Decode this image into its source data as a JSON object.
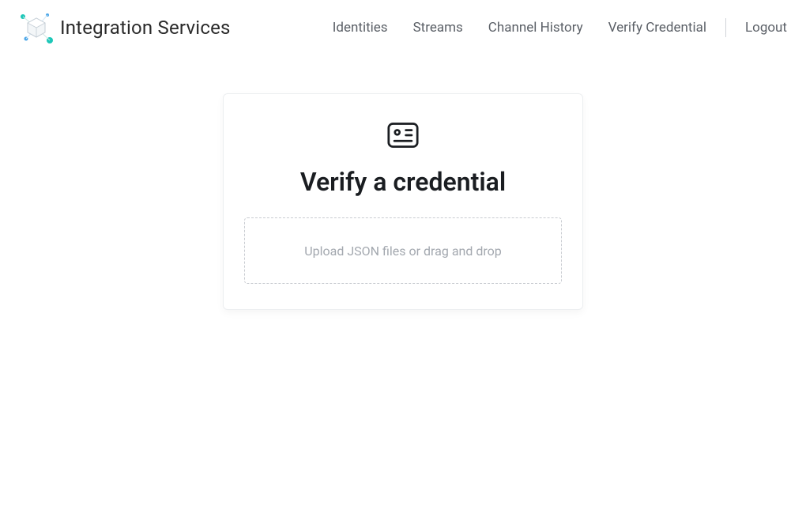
{
  "brand": {
    "title": "Integration Services"
  },
  "nav": {
    "identities": "Identities",
    "streams": "Streams",
    "channel_history": "Channel History",
    "verify_credential": "Verify Credential",
    "logout": "Logout"
  },
  "card": {
    "title": "Verify a credential",
    "dropzone_text": "Upload JSON files or drag and drop"
  }
}
